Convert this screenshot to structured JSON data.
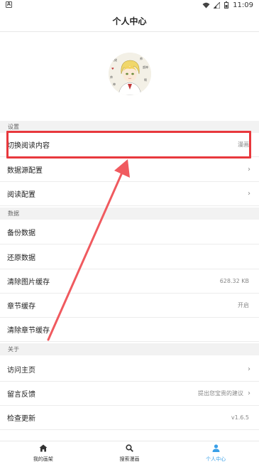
{
  "status": {
    "time": "11:09",
    "badge": "A"
  },
  "header": {
    "title": "个人中心"
  },
  "sections": {
    "settings": "设置",
    "data": "数据",
    "about": "关于"
  },
  "rows": {
    "switch_content": {
      "label": "切换阅读内容",
      "value": "漫画"
    },
    "data_source": {
      "label": "数据源配置"
    },
    "reading_config": {
      "label": "阅读配置"
    },
    "backup": {
      "label": "备份数据"
    },
    "restore": {
      "label": "还原数据"
    },
    "clear_image_cache": {
      "label": "清除图片缓存",
      "value": "628.32 KB"
    },
    "chapter_cache": {
      "label": "章节缓存",
      "value": "开启"
    },
    "clear_chapter_cache": {
      "label": "清除章节缓存"
    },
    "visit_homepage": {
      "label": "访问主页"
    },
    "feedback": {
      "label": "留言反馈",
      "value": "提出您宝贵的建议"
    },
    "check_update": {
      "label": "检查更新",
      "value": "v1.6.5"
    }
  },
  "tabs": [
    {
      "label": "我的画架",
      "icon": "home-icon"
    },
    {
      "label": "搜索漫画",
      "icon": "search-icon"
    },
    {
      "label": "个人中心",
      "icon": "person-icon"
    }
  ],
  "colors": {
    "accent": "#3aa0e8",
    "annotation": "#e8383d"
  }
}
